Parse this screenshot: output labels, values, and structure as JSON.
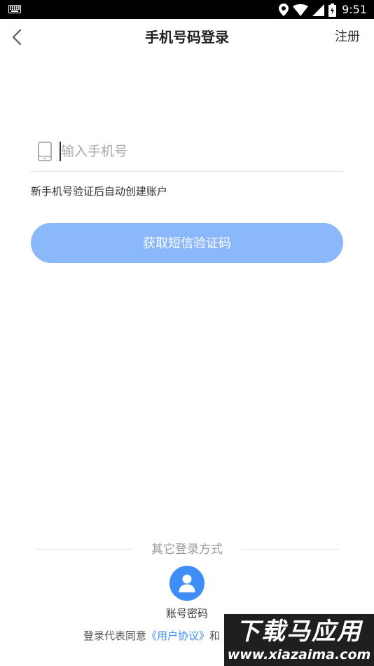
{
  "status_bar": {
    "time": "9:51",
    "icons": [
      "keyboard-icon",
      "location-icon",
      "wifi-icon",
      "signal-icon",
      "battery-icon"
    ]
  },
  "header": {
    "title": "手机号码登录",
    "register_label": "注册",
    "back_icon": "chevron-left-icon"
  },
  "form": {
    "phone_placeholder": "输入手机号",
    "phone_value": "",
    "phone_icon": "mobile-phone-icon",
    "hint": "新手机号验证后自动创建账户",
    "sms_button_label": "获取短信验证码"
  },
  "other_login": {
    "label": "其它登录方式",
    "account_icon": "user-icon",
    "account_label": "账号密码"
  },
  "agreement": {
    "prefix": "登录代表同意",
    "user_agreement": "《用户协议》",
    "suffix": "和"
  },
  "watermark": {
    "title": "下载马应用",
    "url": "www.xiazaima.com"
  },
  "colors": {
    "primary": "#3f8ef7",
    "button_disabled": "#8ab8fb",
    "status_bar": "#000000"
  }
}
